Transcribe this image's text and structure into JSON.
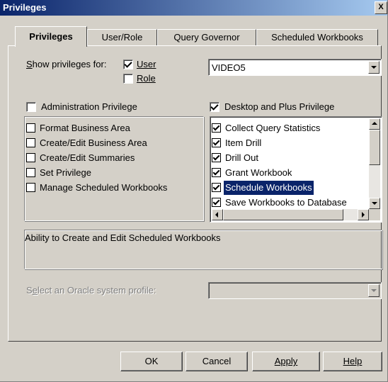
{
  "window": {
    "title": "Privileges",
    "close_glyph": "X"
  },
  "tabs": [
    {
      "label": "Privileges",
      "active": true
    },
    {
      "label": "User/Role",
      "active": false
    },
    {
      "label": "Query Governor",
      "active": false
    },
    {
      "label": "Scheduled Workbooks",
      "active": false
    }
  ],
  "show_for": {
    "label": "Show privileges for:",
    "user_label": "User",
    "user_checked": true,
    "role_label": "Role",
    "role_checked": false,
    "selected": "VIDEO5"
  },
  "admin": {
    "label": "Administration Privilege",
    "checked": false,
    "items": [
      {
        "label": "Format Business Area",
        "checked": false
      },
      {
        "label": "Create/Edit Business Area",
        "checked": false
      },
      {
        "label": "Create/Edit Summaries",
        "checked": false
      },
      {
        "label": "Set Privilege",
        "checked": false
      },
      {
        "label": "Manage Scheduled Workbooks",
        "checked": false
      }
    ]
  },
  "desktop": {
    "label": "Desktop and Plus Privilege",
    "checked": true,
    "items": [
      {
        "label": "Collect Query Statistics",
        "checked": true,
        "selected": false
      },
      {
        "label": "Item Drill",
        "checked": true,
        "selected": false
      },
      {
        "label": "Drill Out",
        "checked": true,
        "selected": false
      },
      {
        "label": "Grant Workbook",
        "checked": true,
        "selected": false
      },
      {
        "label": "Schedule Workbooks",
        "checked": true,
        "selected": true
      },
      {
        "label": "Save Workbooks to Database",
        "checked": true,
        "selected": false
      }
    ]
  },
  "description": "Ability to Create and Edit Scheduled Workbooks",
  "oracle_profile": {
    "label": "Select an Oracle system profile:",
    "value": ""
  },
  "buttons": {
    "ok": "OK",
    "cancel": "Cancel",
    "apply": "Apply",
    "help": "Help"
  },
  "colors": {
    "face": "#d4d0c8",
    "title_start": "#0a246a",
    "title_end": "#a6caf0",
    "selection": "#0a246a"
  }
}
